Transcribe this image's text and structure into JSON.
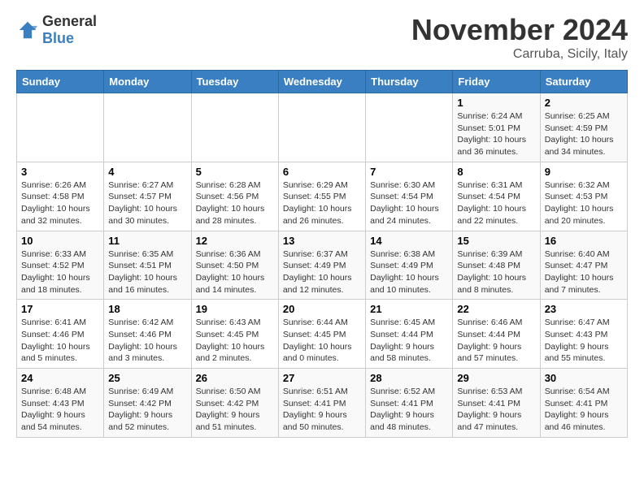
{
  "header": {
    "logo_general": "General",
    "logo_blue": "Blue",
    "month_title": "November 2024",
    "subtitle": "Carruba, Sicily, Italy"
  },
  "days_of_week": [
    "Sunday",
    "Monday",
    "Tuesday",
    "Wednesday",
    "Thursday",
    "Friday",
    "Saturday"
  ],
  "weeks": [
    [
      {
        "day": "",
        "info": ""
      },
      {
        "day": "",
        "info": ""
      },
      {
        "day": "",
        "info": ""
      },
      {
        "day": "",
        "info": ""
      },
      {
        "day": "",
        "info": ""
      },
      {
        "day": "1",
        "info": "Sunrise: 6:24 AM\nSunset: 5:01 PM\nDaylight: 10 hours and 36 minutes."
      },
      {
        "day": "2",
        "info": "Sunrise: 6:25 AM\nSunset: 4:59 PM\nDaylight: 10 hours and 34 minutes."
      }
    ],
    [
      {
        "day": "3",
        "info": "Sunrise: 6:26 AM\nSunset: 4:58 PM\nDaylight: 10 hours and 32 minutes."
      },
      {
        "day": "4",
        "info": "Sunrise: 6:27 AM\nSunset: 4:57 PM\nDaylight: 10 hours and 30 minutes."
      },
      {
        "day": "5",
        "info": "Sunrise: 6:28 AM\nSunset: 4:56 PM\nDaylight: 10 hours and 28 minutes."
      },
      {
        "day": "6",
        "info": "Sunrise: 6:29 AM\nSunset: 4:55 PM\nDaylight: 10 hours and 26 minutes."
      },
      {
        "day": "7",
        "info": "Sunrise: 6:30 AM\nSunset: 4:54 PM\nDaylight: 10 hours and 24 minutes."
      },
      {
        "day": "8",
        "info": "Sunrise: 6:31 AM\nSunset: 4:54 PM\nDaylight: 10 hours and 22 minutes."
      },
      {
        "day": "9",
        "info": "Sunrise: 6:32 AM\nSunset: 4:53 PM\nDaylight: 10 hours and 20 minutes."
      }
    ],
    [
      {
        "day": "10",
        "info": "Sunrise: 6:33 AM\nSunset: 4:52 PM\nDaylight: 10 hours and 18 minutes."
      },
      {
        "day": "11",
        "info": "Sunrise: 6:35 AM\nSunset: 4:51 PM\nDaylight: 10 hours and 16 minutes."
      },
      {
        "day": "12",
        "info": "Sunrise: 6:36 AM\nSunset: 4:50 PM\nDaylight: 10 hours and 14 minutes."
      },
      {
        "day": "13",
        "info": "Sunrise: 6:37 AM\nSunset: 4:49 PM\nDaylight: 10 hours and 12 minutes."
      },
      {
        "day": "14",
        "info": "Sunrise: 6:38 AM\nSunset: 4:49 PM\nDaylight: 10 hours and 10 minutes."
      },
      {
        "day": "15",
        "info": "Sunrise: 6:39 AM\nSunset: 4:48 PM\nDaylight: 10 hours and 8 minutes."
      },
      {
        "day": "16",
        "info": "Sunrise: 6:40 AM\nSunset: 4:47 PM\nDaylight: 10 hours and 7 minutes."
      }
    ],
    [
      {
        "day": "17",
        "info": "Sunrise: 6:41 AM\nSunset: 4:46 PM\nDaylight: 10 hours and 5 minutes."
      },
      {
        "day": "18",
        "info": "Sunrise: 6:42 AM\nSunset: 4:46 PM\nDaylight: 10 hours and 3 minutes."
      },
      {
        "day": "19",
        "info": "Sunrise: 6:43 AM\nSunset: 4:45 PM\nDaylight: 10 hours and 2 minutes."
      },
      {
        "day": "20",
        "info": "Sunrise: 6:44 AM\nSunset: 4:45 PM\nDaylight: 10 hours and 0 minutes."
      },
      {
        "day": "21",
        "info": "Sunrise: 6:45 AM\nSunset: 4:44 PM\nDaylight: 9 hours and 58 minutes."
      },
      {
        "day": "22",
        "info": "Sunrise: 6:46 AM\nSunset: 4:44 PM\nDaylight: 9 hours and 57 minutes."
      },
      {
        "day": "23",
        "info": "Sunrise: 6:47 AM\nSunset: 4:43 PM\nDaylight: 9 hours and 55 minutes."
      }
    ],
    [
      {
        "day": "24",
        "info": "Sunrise: 6:48 AM\nSunset: 4:43 PM\nDaylight: 9 hours and 54 minutes."
      },
      {
        "day": "25",
        "info": "Sunrise: 6:49 AM\nSunset: 4:42 PM\nDaylight: 9 hours and 52 minutes."
      },
      {
        "day": "26",
        "info": "Sunrise: 6:50 AM\nSunset: 4:42 PM\nDaylight: 9 hours and 51 minutes."
      },
      {
        "day": "27",
        "info": "Sunrise: 6:51 AM\nSunset: 4:41 PM\nDaylight: 9 hours and 50 minutes."
      },
      {
        "day": "28",
        "info": "Sunrise: 6:52 AM\nSunset: 4:41 PM\nDaylight: 9 hours and 48 minutes."
      },
      {
        "day": "29",
        "info": "Sunrise: 6:53 AM\nSunset: 4:41 PM\nDaylight: 9 hours and 47 minutes."
      },
      {
        "day": "30",
        "info": "Sunrise: 6:54 AM\nSunset: 4:41 PM\nDaylight: 9 hours and 46 minutes."
      }
    ]
  ]
}
